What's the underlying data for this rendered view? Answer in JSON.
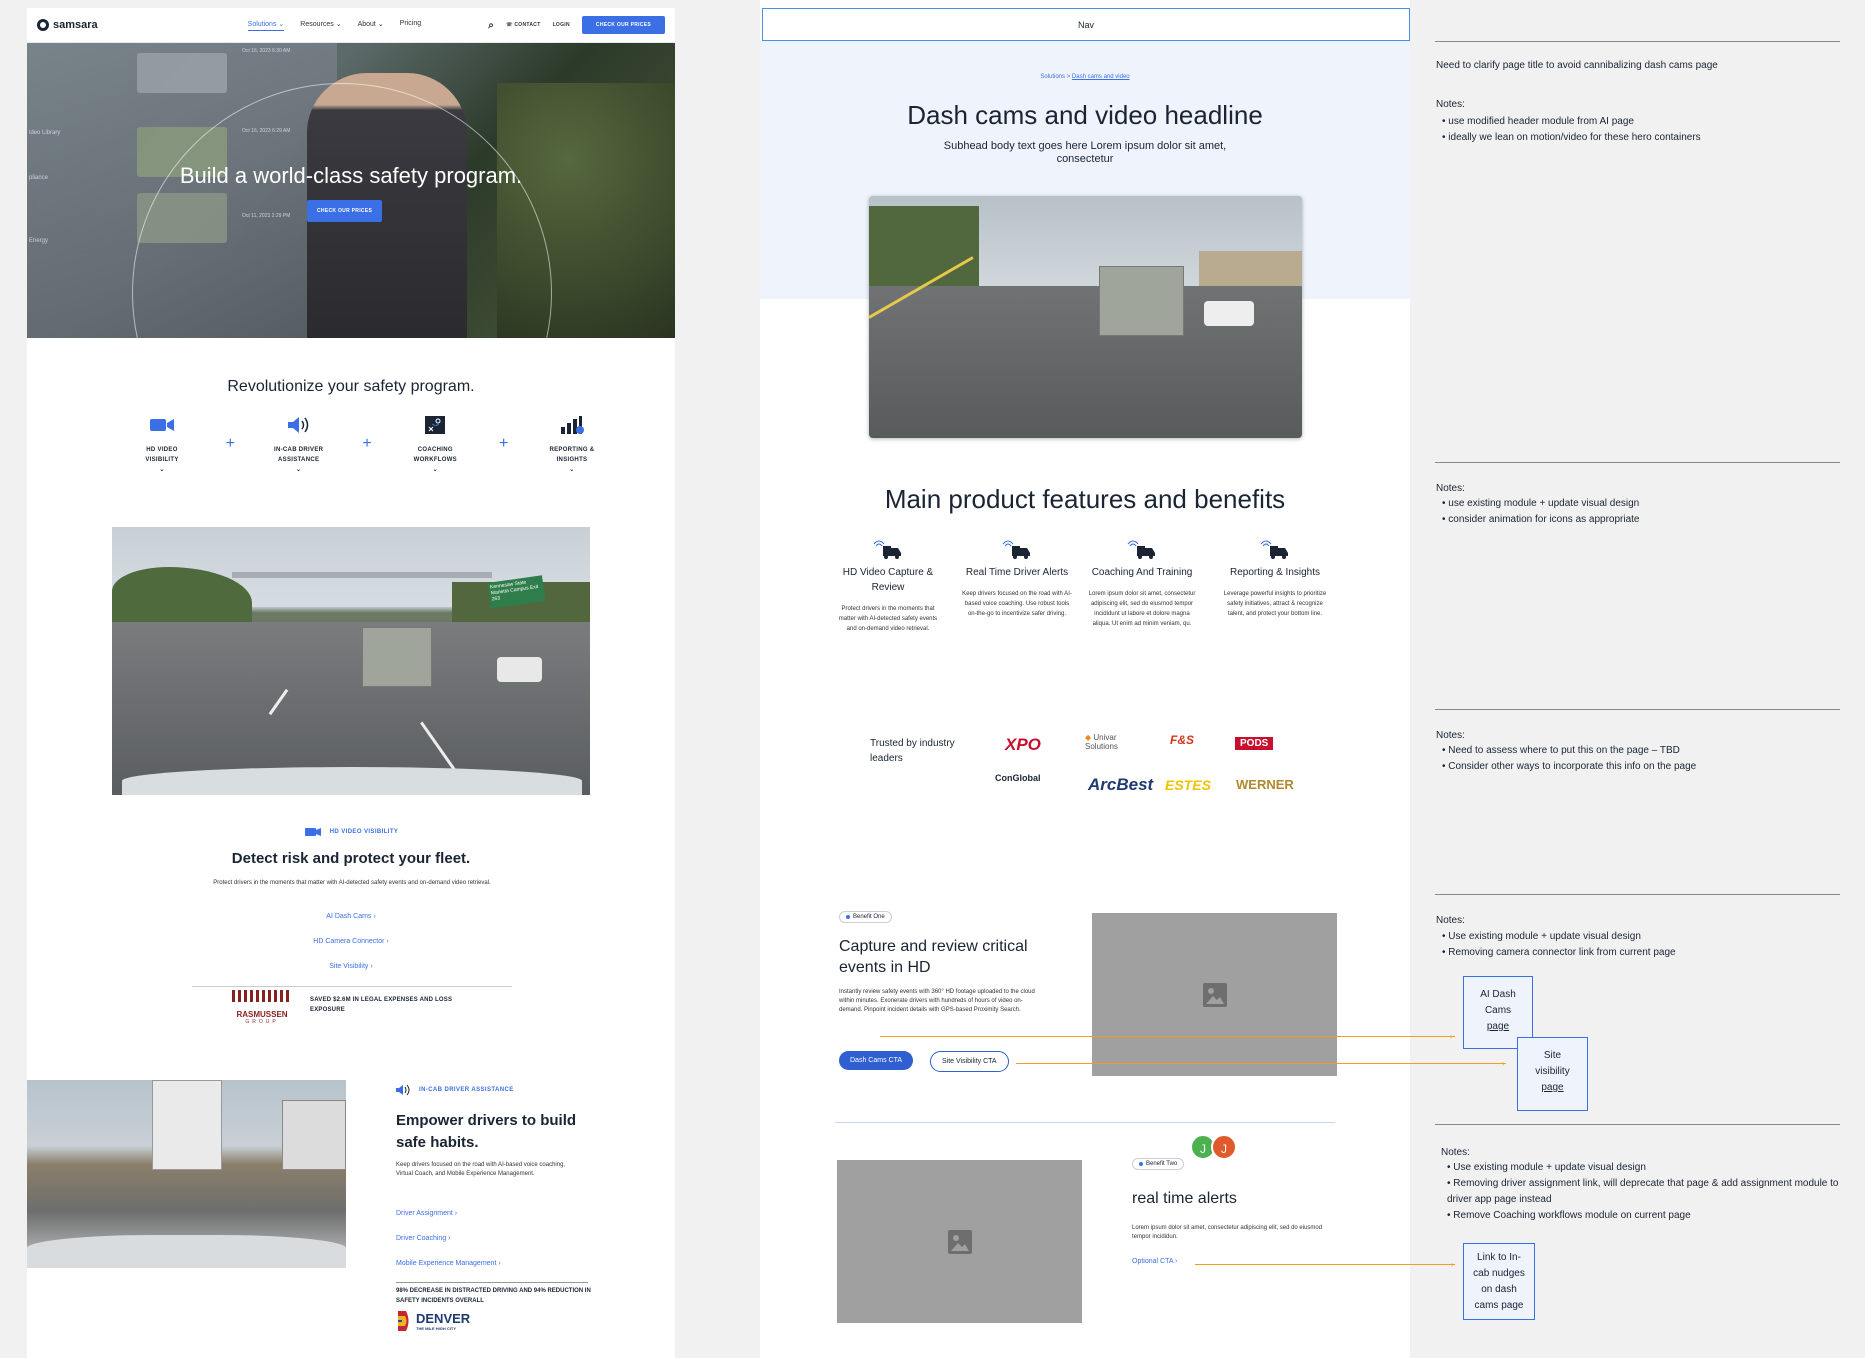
{
  "live": {
    "logo": "samsara",
    "nav": {
      "items": [
        {
          "label": "Solutions",
          "chevron": true
        },
        {
          "label": "Resources",
          "chevron": true
        },
        {
          "label": "About",
          "chevron": true
        },
        {
          "label": "Pricing",
          "chevron": false
        }
      ],
      "contact": "CONTACT",
      "login": "LOGIN",
      "cta": "CHECK OUR PRICES"
    },
    "hero": {
      "title": "Build a world-class safety program.",
      "cta": "CHECK OUR PRICES",
      "screen_text": [
        "Oct 16, 2023 6:30 AM",
        "Oct 16, 2023 6:29 AM",
        "Oct 11, 2023 2:29 PM",
        "ideo Library",
        "pliance",
        "Energy"
      ]
    },
    "section1_title": "Revolutionize your safety program.",
    "features": [
      {
        "line1": "HD VIDEO",
        "line2": "VISIBILITY",
        "icon": "video-camera-icon"
      },
      {
        "line1": "IN-CAB DRIVER",
        "line2": "ASSISTANCE",
        "icon": "speaker-icon"
      },
      {
        "line1": "COACHING",
        "line2": "WORKFLOWS",
        "icon": "coaching-board-icon"
      },
      {
        "line1": "REPORTING &",
        "line2": "INSIGHTS",
        "icon": "bar-chart-icon"
      }
    ],
    "road_sign": "Kennesaw State Marietta Campus Exit 263",
    "hd": {
      "tag": "HD VIDEO VISIBILITY",
      "title": "Detect risk and protect your fleet.",
      "body": "Protect drivers in the moments that matter with AI-detected safety events and on-demand video retrieval.",
      "links": [
        "AI Dash Cams ›",
        "HD Camera Connector ›",
        "Site Visibility ›"
      ],
      "customer_logo_top": "RASMUSSEN",
      "customer_logo_bottom": "GROUP",
      "stat": "SAVED $2.6M IN LEGAL EXPENSES AND LOSS EXPOSURE"
    },
    "incab": {
      "tag": "IN-CAB DRIVER ASSISTANCE",
      "title_l1": "Empower drivers to build",
      "title_l2": "safe habits.",
      "body": "Keep drivers focused on the road with AI-based voice coaching, Virtual Coach, and Mobile Experience Management.",
      "links": [
        "Driver Assignment ›",
        "Driver Coaching ›",
        "Mobile Experience Management ›"
      ],
      "stat": "98% DECREASE IN DISTRACTED DRIVING AND 94% REDUCTION IN SAFETY INCIDENTS OVERALL",
      "customer_logo": "DENVER",
      "customer_sub": "THE MILE HIGH CITY"
    }
  },
  "wire": {
    "nav": "Nav",
    "breadcrumb_parent": "Solutions",
    "breadcrumb_sep": ">",
    "breadcrumb_current": "Dash cams and video",
    "headline": "Dash cams and video headline",
    "subhead": "Subhead body text goes here Lorem ipsum dolor sit amet, consectetur",
    "features_title": "Main product features and benefits",
    "features": [
      {
        "title": "HD Video Capture & Review",
        "body": "Protect drivers in the moments that matter with AI-detected safety events and on-demand video retrieval."
      },
      {
        "title": "Real Time Driver Alerts",
        "body": "Keep drivers focused on the road with AI-based voice coaching. Use robust tools on-the-go to incentivize safer driving."
      },
      {
        "title": "Coaching And Training",
        "body": "Lorem ipsum dolor sit amet, consectetur adipiscing elit, sed do eiusmod tempor incididunt ut labore et dolore magna aliqua. Ut enim ad minim veniam, qu."
      },
      {
        "title": "Reporting & Insights",
        "body": "Leverage powerful insights to prioritize safety initiatives, attract & recognize talent, and protect your bottom line."
      }
    ],
    "trusted": "Trusted by industry leaders",
    "logos": [
      "XPO",
      "Univar Solutions",
      "F&S",
      "PODS",
      "ConGlobal",
      "ArcBest",
      "ESTES",
      "WERNER"
    ],
    "benefit1": {
      "pill": "Benefit One",
      "title": "Capture and review critical events in HD",
      "body": "Instantly review safety events with 360° HD footage uploaded to the cloud within minutes. Exonerate drivers with hundreds of hours of video on-demand. Pinpoint incident details with GPS-based Proximity Search.",
      "cta1": "Dash Cams CTA",
      "cta2": "Site Visibility CTA"
    },
    "benefit2": {
      "pill": "Benefit Two",
      "title": "real time alerts",
      "body": "Lorem ipsum dolor sit amet, consectetur adipiscing elit, sed do eiusmod tempor incididun.",
      "cta": "Optional CTA ›",
      "avatars": [
        "J",
        "J"
      ]
    }
  },
  "notes": {
    "n0": {
      "heading": "Need to clarify page title to avoid cannibalizing dash cams page",
      "label": "Notes:",
      "items": [
        "use modified header module from AI page",
        "ideally we lean on motion/video for these hero containers"
      ]
    },
    "n1": {
      "label": "Notes:",
      "items": [
        "use existing module + update visual design",
        "consider animation for icons as appropriate"
      ]
    },
    "n2": {
      "label": "Notes:",
      "items": [
        "Need to assess where to put this on the page – TBD",
        "Consider other ways to incorporate this info on the page"
      ]
    },
    "n3": {
      "label": "Notes:",
      "items": [
        "Use existing module + update visual design",
        "Removing camera connector link from current page"
      ],
      "box1": [
        "AI Dash",
        "Cams",
        "page"
      ],
      "box2": [
        "Site",
        "visibility",
        "page"
      ]
    },
    "n4": {
      "label": "Notes:",
      "items": [
        "Use existing module + update visual design",
        "Removing driver assignment link, will deprecate that page & add assignment module to driver app page instead",
        "Remove Coaching workflows module on current page"
      ],
      "box": [
        "Link to In-",
        "cab nudges",
        "on dash",
        "cams page"
      ]
    }
  },
  "colors": {
    "accent": "#3b6fe6",
    "dark": "#1a2433",
    "band": "#eef3fc",
    "placeholder": "#a0a0a0",
    "connector": "#f0a020",
    "avatar1": "#4caf50",
    "avatar2": "#e05a2b"
  }
}
